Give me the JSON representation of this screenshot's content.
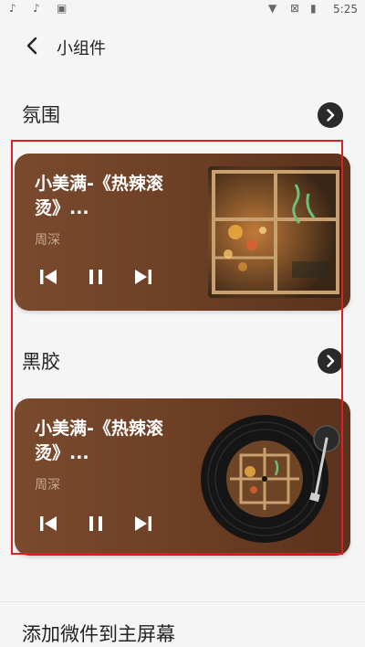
{
  "status_bar": {
    "time": "5:25"
  },
  "header": {
    "title": "小组件"
  },
  "sections": [
    {
      "title": "氛围"
    },
    {
      "title": "黑胶"
    }
  ],
  "widgets": [
    {
      "song_title": "小美满-《热辣滚烫》...",
      "artist": "周深"
    },
    {
      "song_title": "小美满-《热辣滚烫》...",
      "artist": "周深"
    }
  ],
  "footer": {
    "add_to_home": "添加微件到主屏幕"
  },
  "colors": {
    "card_brown": "#7a4a2e",
    "highlight_red": "#e02020",
    "artist_tan": "#c8a890"
  }
}
